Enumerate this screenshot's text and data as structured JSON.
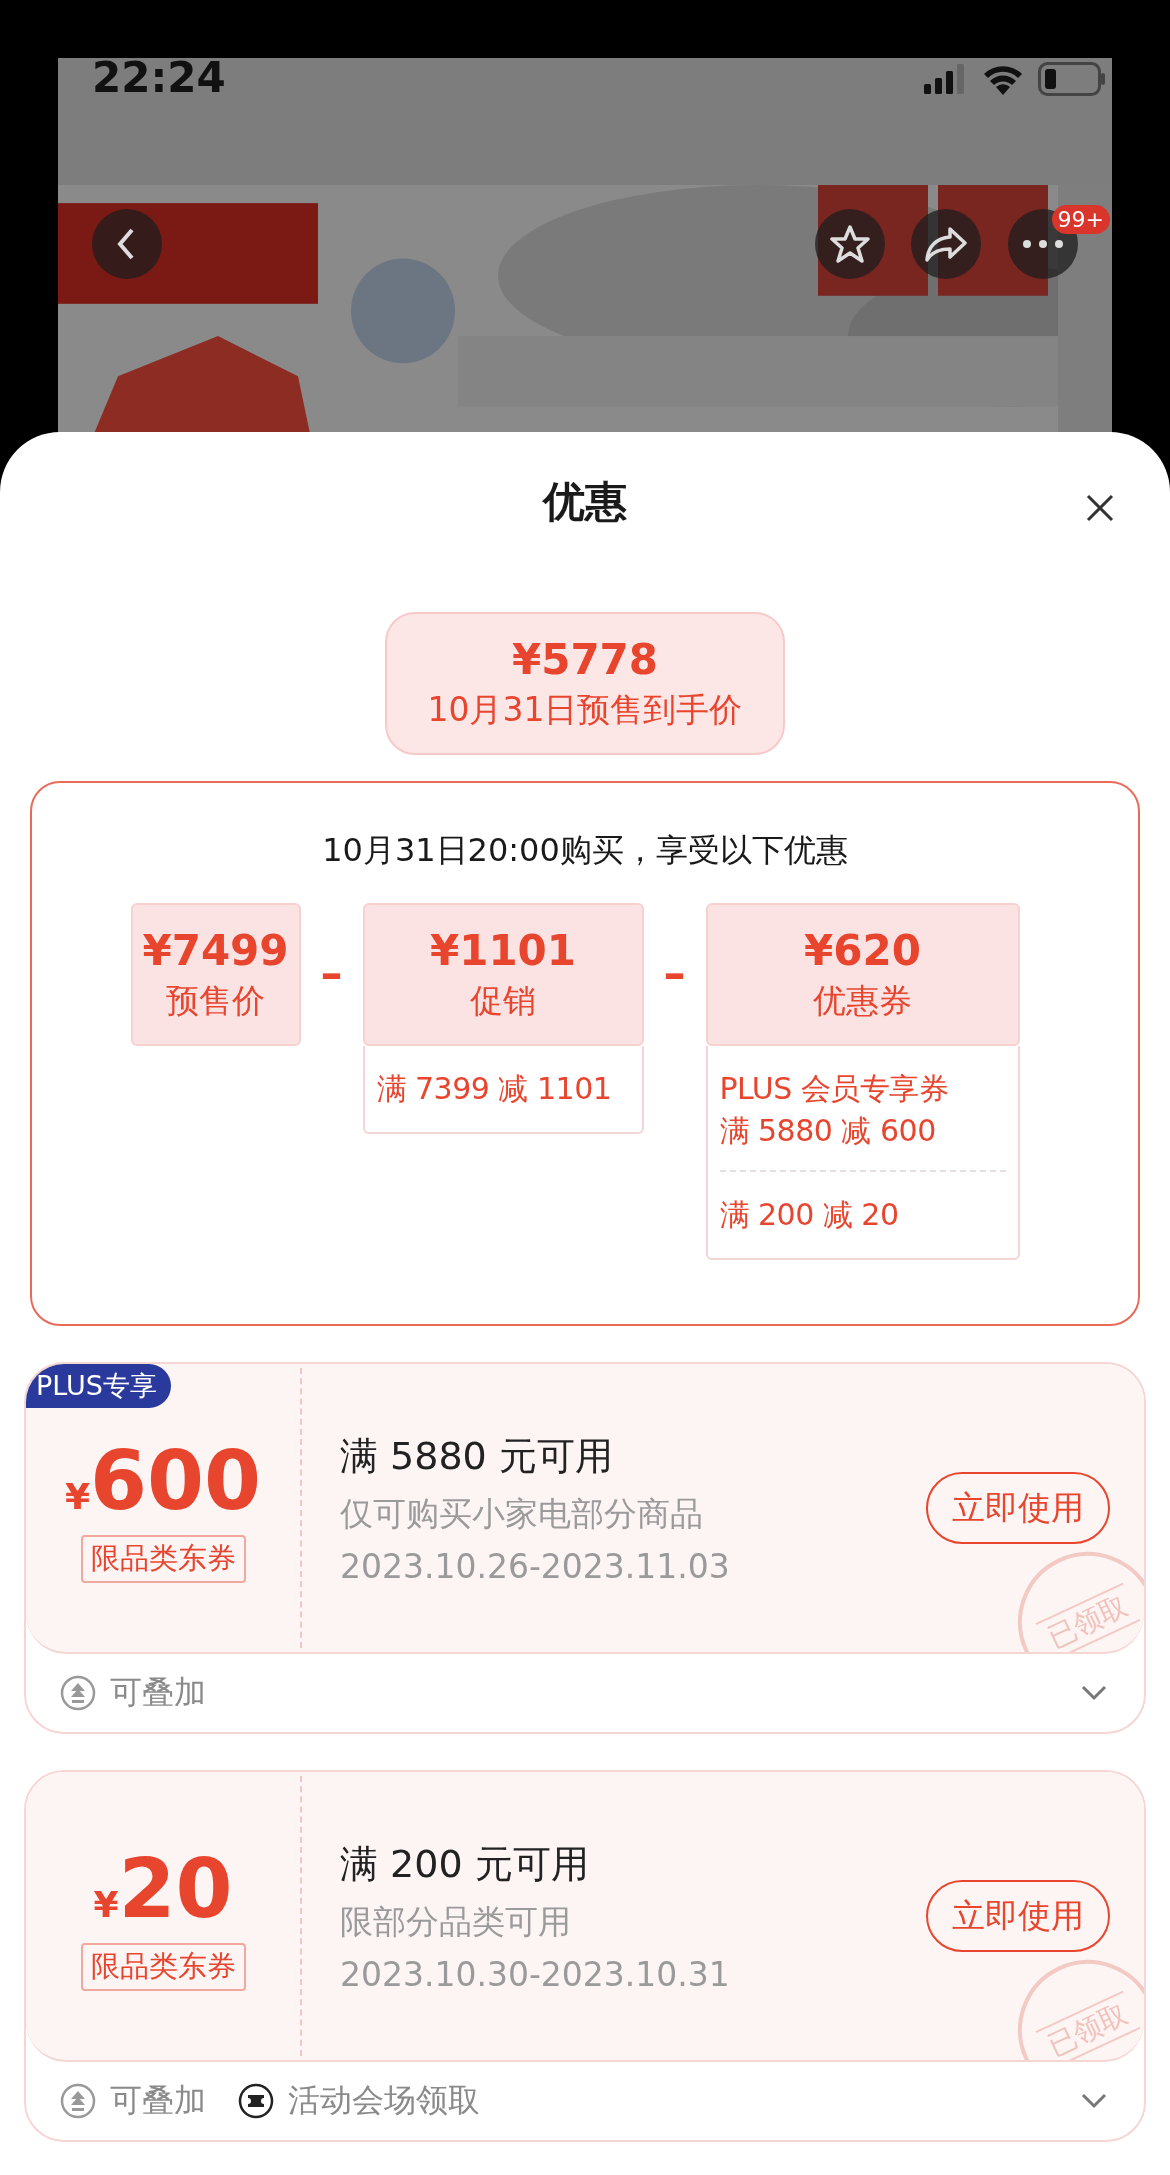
{
  "status_bar": {
    "time": "22:24"
  },
  "header": {
    "badge": "99+"
  },
  "sheet": {
    "title": "优惠"
  },
  "price_summary": {
    "amount": "¥5778",
    "label": "10月31日预售到手价"
  },
  "breakdown": {
    "heading": "10月31日20:00购买，享受以下优惠",
    "items": [
      {
        "amount": "¥7499",
        "label": "预售价"
      },
      {
        "operator": "–",
        "amount": "¥1101",
        "label": "促销",
        "details": [
          [
            "满 7399 减 1101"
          ]
        ]
      },
      {
        "operator": "–",
        "amount": "¥620",
        "label": "优惠券",
        "details": [
          [
            "PLUS 会员专享券",
            "满 5880 减 600"
          ],
          [
            "满 200 减 20"
          ]
        ]
      }
    ]
  },
  "coupons": [
    {
      "badge": "PLUS专享",
      "currency": "¥",
      "amount": "600",
      "tag": "限品类东券",
      "condition": "满 5880 元可用",
      "scope": "仅可购买小家电部分商品",
      "validity": "2023.10.26-2023.11.03",
      "button": "立即使用",
      "stamp": "已领取",
      "expanded": false,
      "features": [
        {
          "kind": "stack",
          "label": "可叠加"
        }
      ]
    },
    {
      "currency": "¥",
      "amount": "20",
      "tag": "限品类东券",
      "condition": "满 200 元可用",
      "scope": "限部分品类可用",
      "validity": "2023.10.30-2023.10.31",
      "button": "立即使用",
      "stamp": "已领取",
      "expanded": false,
      "features": [
        {
          "kind": "stack",
          "label": "可叠加"
        },
        {
          "kind": "venue",
          "label": "活动会场领取"
        }
      ]
    }
  ]
}
